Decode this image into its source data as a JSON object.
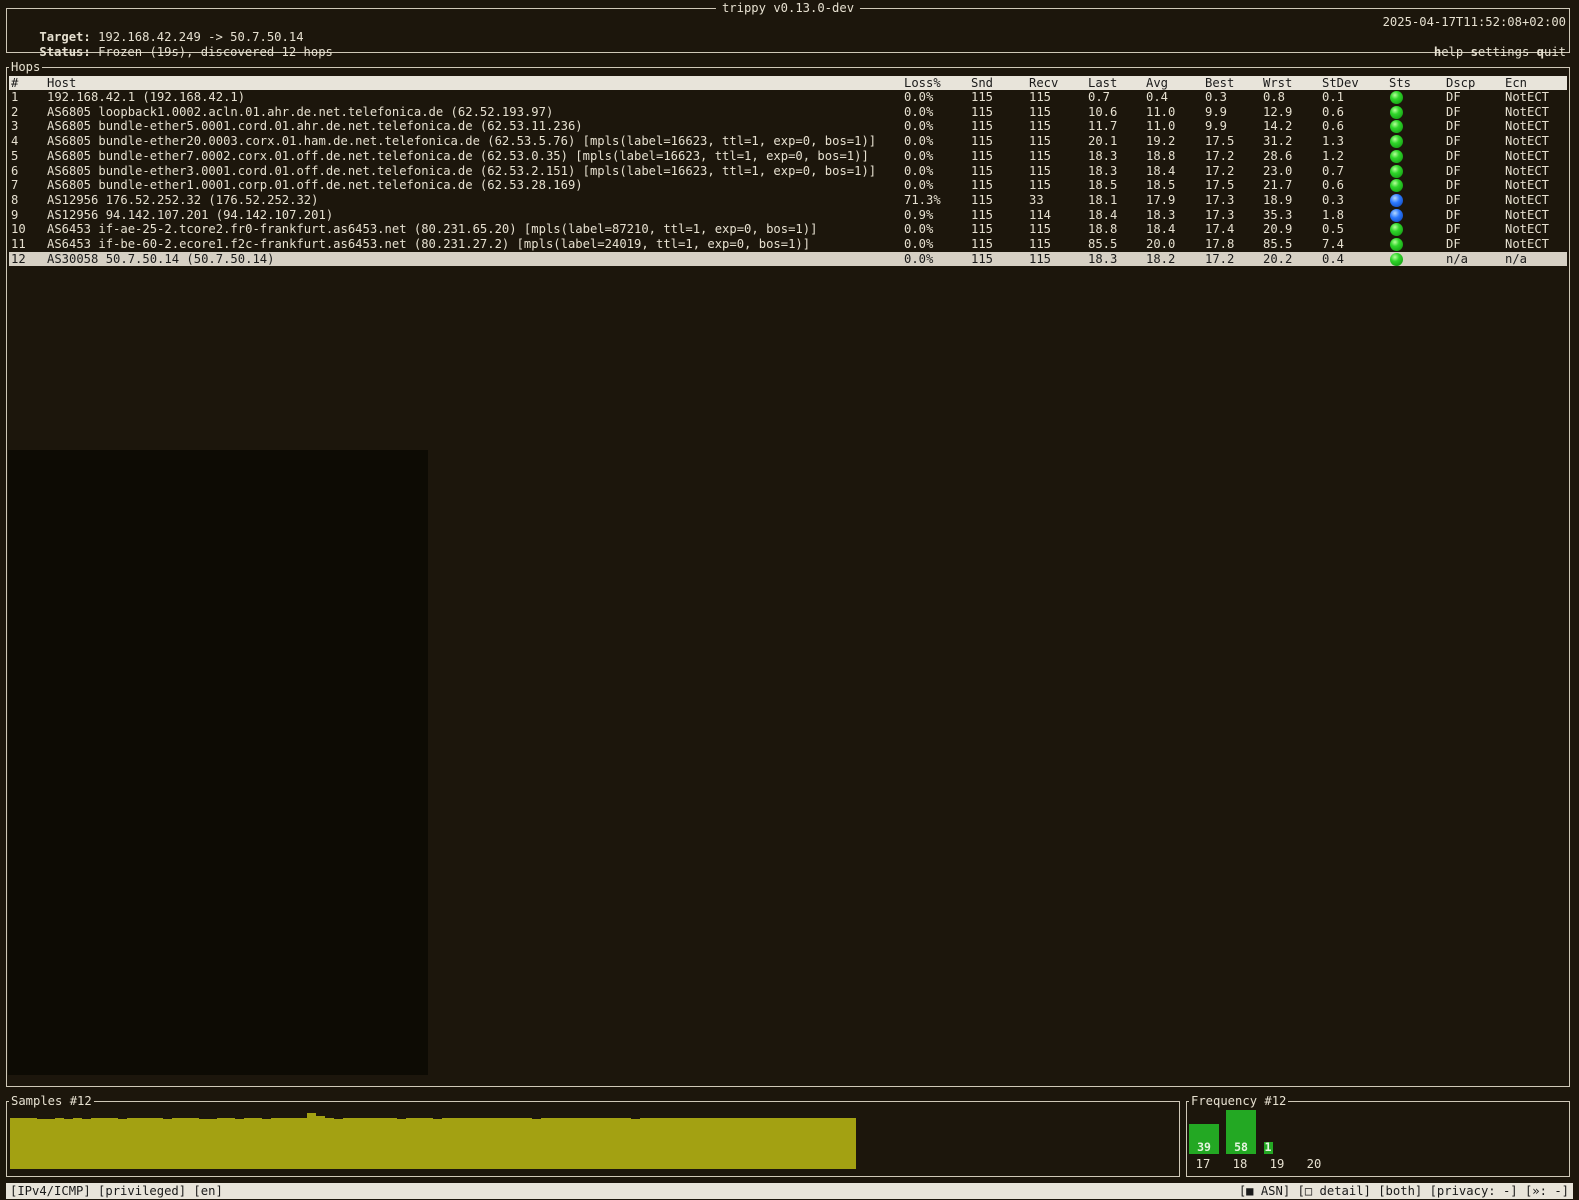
{
  "app": {
    "title": "trippy v0.13.0-dev"
  },
  "header": {
    "target_label": "Target:",
    "target_value": "192.168.42.249 -> 50.7.50.14",
    "status_label": "Status:",
    "status_value": "Frozen (19s), discovered 12 hops",
    "timestamp": "2025-04-17T11:52:08+02:00",
    "help_hot": "h",
    "help_rest": "elp",
    "settings_hot": "s",
    "settings_rest": "ettings",
    "quit_hot": "q",
    "quit_rest": "uit"
  },
  "hops": {
    "title": "Hops",
    "columns": [
      "#",
      "Host",
      "Loss%",
      "Snd",
      "Recv",
      "Last",
      "Avg",
      "Best",
      "Wrst",
      "StDev",
      "Sts",
      "Dscp",
      "Ecn"
    ],
    "selected_row": 11,
    "rows": [
      {
        "num": "1",
        "host": "192.168.42.1 (192.168.42.1)",
        "loss": "0.0%",
        "snd": "115",
        "recv": "115",
        "last": "0.7",
        "avg": "0.4",
        "best": "0.3",
        "wrst": "0.8",
        "stdev": "0.1",
        "sts": "green",
        "dscp": "DF",
        "ecn": "NotECT"
      },
      {
        "num": "2",
        "host": "AS6805 loopback1.0002.acln.01.ahr.de.net.telefonica.de (62.52.193.97)",
        "loss": "0.0%",
        "snd": "115",
        "recv": "115",
        "last": "10.6",
        "avg": "11.0",
        "best": "9.9",
        "wrst": "12.9",
        "stdev": "0.6",
        "sts": "green",
        "dscp": "DF",
        "ecn": "NotECT"
      },
      {
        "num": "3",
        "host": "AS6805 bundle-ether5.0001.cord.01.ahr.de.net.telefonica.de (62.53.11.236)",
        "loss": "0.0%",
        "snd": "115",
        "recv": "115",
        "last": "11.7",
        "avg": "11.0",
        "best": "9.9",
        "wrst": "14.2",
        "stdev": "0.6",
        "sts": "green",
        "dscp": "DF",
        "ecn": "NotECT"
      },
      {
        "num": "4",
        "host": "AS6805 bundle-ether20.0003.corx.01.ham.de.net.telefonica.de (62.53.5.76) [mpls(label=16623, ttl=1, exp=0, bos=1)]",
        "loss": "0.0%",
        "snd": "115",
        "recv": "115",
        "last": "20.1",
        "avg": "19.2",
        "best": "17.5",
        "wrst": "31.2",
        "stdev": "1.3",
        "sts": "green",
        "dscp": "DF",
        "ecn": "NotECT"
      },
      {
        "num": "5",
        "host": "AS6805 bundle-ether7.0002.corx.01.off.de.net.telefonica.de (62.53.0.35) [mpls(label=16623, ttl=1, exp=0, bos=1)]",
        "loss": "0.0%",
        "snd": "115",
        "recv": "115",
        "last": "18.3",
        "avg": "18.8",
        "best": "17.2",
        "wrst": "28.6",
        "stdev": "1.2",
        "sts": "green",
        "dscp": "DF",
        "ecn": "NotECT"
      },
      {
        "num": "6",
        "host": "AS6805 bundle-ether3.0001.cord.01.off.de.net.telefonica.de (62.53.2.151) [mpls(label=16623, ttl=1, exp=0, bos=1)]",
        "loss": "0.0%",
        "snd": "115",
        "recv": "115",
        "last": "18.3",
        "avg": "18.4",
        "best": "17.2",
        "wrst": "23.0",
        "stdev": "0.7",
        "sts": "green",
        "dscp": "DF",
        "ecn": "NotECT"
      },
      {
        "num": "7",
        "host": "AS6805 bundle-ether1.0001.corp.01.off.de.net.telefonica.de (62.53.28.169)",
        "loss": "0.0%",
        "snd": "115",
        "recv": "115",
        "last": "18.5",
        "avg": "18.5",
        "best": "17.5",
        "wrst": "21.7",
        "stdev": "0.6",
        "sts": "green",
        "dscp": "DF",
        "ecn": "NotECT"
      },
      {
        "num": "8",
        "host": "AS12956 176.52.252.32 (176.52.252.32)",
        "loss": "71.3%",
        "snd": "115",
        "recv": "33",
        "last": "18.1",
        "avg": "17.9",
        "best": "17.3",
        "wrst": "18.9",
        "stdev": "0.3",
        "sts": "blue",
        "dscp": "DF",
        "ecn": "NotECT"
      },
      {
        "num": "9",
        "host": "AS12956 94.142.107.201 (94.142.107.201)",
        "loss": "0.9%",
        "snd": "115",
        "recv": "114",
        "last": "18.4",
        "avg": "18.3",
        "best": "17.3",
        "wrst": "35.3",
        "stdev": "1.8",
        "sts": "blue",
        "dscp": "DF",
        "ecn": "NotECT"
      },
      {
        "num": "10",
        "host": "AS6453 if-ae-25-2.tcore2.fr0-frankfurt.as6453.net (80.231.65.20) [mpls(label=87210, ttl=1, exp=0, bos=1)]",
        "loss": "0.0%",
        "snd": "115",
        "recv": "115",
        "last": "18.8",
        "avg": "18.4",
        "best": "17.4",
        "wrst": "20.9",
        "stdev": "0.5",
        "sts": "green",
        "dscp": "DF",
        "ecn": "NotECT"
      },
      {
        "num": "11",
        "host": "AS6453 if-be-60-2.ecore1.f2c-frankfurt.as6453.net (80.231.27.2) [mpls(label=24019, ttl=1, exp=0, bos=1)]",
        "loss": "0.0%",
        "snd": "115",
        "recv": "115",
        "last": "85.5",
        "avg": "20.0",
        "best": "17.8",
        "wrst": "85.5",
        "stdev": "7.4",
        "sts": "green",
        "dscp": "DF",
        "ecn": "NotECT"
      },
      {
        "num": "12",
        "host": "AS30058 50.7.50.14 (50.7.50.14)",
        "loss": "0.0%",
        "snd": "115",
        "recv": "115",
        "last": "18.3",
        "avg": "18.2",
        "best": "17.2",
        "wrst": "20.2",
        "stdev": "0.4",
        "sts": "green",
        "dscp": "n/a",
        "ecn": "n/a"
      }
    ]
  },
  "samples": {
    "title": "Samples #12",
    "values": [
      18.3,
      18.3,
      18.4,
      18.2,
      18.2,
      18.3,
      18.2,
      18.4,
      18.1,
      18.3,
      18.3,
      18.5,
      18.0,
      18.3,
      18.3,
      18.3,
      18.4,
      18.2,
      18.3,
      18.3,
      18.3,
      18.1,
      18.1,
      18.3,
      18.3,
      18.2,
      18.3,
      18.3,
      18.1,
      18.3,
      18.3,
      18.3,
      18.3,
      20.2,
      19.1,
      18.3,
      18.1,
      18.3,
      18.3,
      18.3,
      18.3,
      18.3,
      18.3,
      18.1,
      18.3,
      18.3,
      18.3,
      18.1,
      18.3,
      18.3,
      18.3,
      18.3,
      18.3,
      18.3,
      18.3,
      18.3,
      18.3,
      18.3,
      18.1,
      18.3,
      18.3,
      18.3,
      18.3,
      18.3,
      18.3,
      18.3,
      18.3,
      18.3,
      18.3,
      18.1,
      18.3,
      18.3,
      18.3,
      18.3,
      18.3,
      18.3,
      18.3,
      18.3,
      18.3,
      18.3,
      18.3,
      18.3,
      18.3,
      18.3,
      18.3,
      18.3,
      18.3,
      18.3,
      18.3,
      18.3,
      18.3,
      18.3,
      18.3,
      18.3,
      18.3,
      18.3,
      18.3,
      18.3,
      18.3,
      18.3,
      18.3,
      18.3,
      18.3,
      18.3,
      18.3,
      18.3,
      18.3,
      18.3,
      18.3,
      18.3,
      18.3,
      18.3,
      18.3,
      18.3,
      18.3,
      18.3,
      18.3,
      18.3,
      18.3,
      18.3,
      18.3,
      18.3,
      18.3,
      18.3,
      18.3,
      18.3,
      18.3,
      18.3,
      18.3,
      18.3,
      18.3,
      18.3,
      18.3,
      18.3,
      18.3,
      18.3,
      18.3,
      18.3,
      18.3,
      18.3,
      18.3,
      18.3,
      18.3,
      18.3,
      18.3,
      18.3,
      18.3,
      18.3,
      18.3,
      18.3,
      18.3,
      18.3,
      18.3,
      18.3,
      18.3,
      18.3,
      18.3,
      18.3,
      18.3,
      18.3,
      18.3,
      18.3,
      18.3,
      18.3,
      18.3,
      18.3,
      18.3,
      18.3,
      18.3,
      18.3,
      18.3,
      18.3,
      18.3,
      18.3,
      18.3,
      18.3,
      18.3,
      18.3,
      18.3,
      18.3,
      18.3,
      18.3,
      18.3,
      18.3,
      18.3,
      18.3,
      18.3,
      18.3,
      18.3,
      18.3,
      18.3,
      18.3,
      18.3,
      18.3,
      18.3,
      18.3,
      18.3,
      18.3,
      18.3,
      18.3,
      18.3,
      18.3,
      18.3,
      18.3,
      18.3,
      18.3,
      18.3,
      18.3,
      18.3,
      18.3,
      18.3,
      18.3,
      18.3,
      18.3,
      18.3,
      18.3,
      18.3,
      18.3,
      18.3,
      18.3,
      18.3,
      18.3,
      18.3,
      18.3,
      18.3,
      18.3,
      18.3,
      18.3,
      18.3,
      18.3,
      18.3,
      18.3,
      18.3,
      18.3,
      18.3,
      18.3,
      18.3,
      18.3,
      18.3,
      18.3,
      18.3,
      18.3,
      18.3,
      18.3,
      18.3,
      18.3,
      18.3,
      18.3,
      18.3,
      18.3,
      18.3,
      18.3,
      18.3,
      18.3,
      18.3,
      18.3,
      18.3,
      18.3,
      18.3,
      18.3,
      18.3,
      18.3,
      18.3,
      18.3,
      18.3,
      18.3,
      18.3,
      18.3,
      18.3,
      18.3,
      18.3,
      18.3,
      18.3,
      18.3,
      18.3,
      18.3,
      18.3,
      18.3,
      18.3,
      18.3,
      18.3,
      18.3,
      18.3,
      18.3,
      18.3
    ],
    "ymax": 21.0,
    "color": "#a3a112"
  },
  "frequency": {
    "title": "Frequency #12",
    "bars": [
      {
        "label": "17",
        "count": 39
      },
      {
        "label": "18",
        "count": 58
      },
      {
        "label": "19",
        "count": 1
      },
      {
        "label": "20",
        "count": 0
      }
    ],
    "max_count": 58,
    "color": "#23a823"
  },
  "footer": {
    "left": "[IPv4/ICMP] [privileged] [en]",
    "right": "[■ ASN] [□ detail] [both] [privacy: -] [»: -]"
  },
  "colors": {
    "green_status": "#2fd62a",
    "blue_status": "#2b78ff",
    "background": "#1c160c"
  }
}
